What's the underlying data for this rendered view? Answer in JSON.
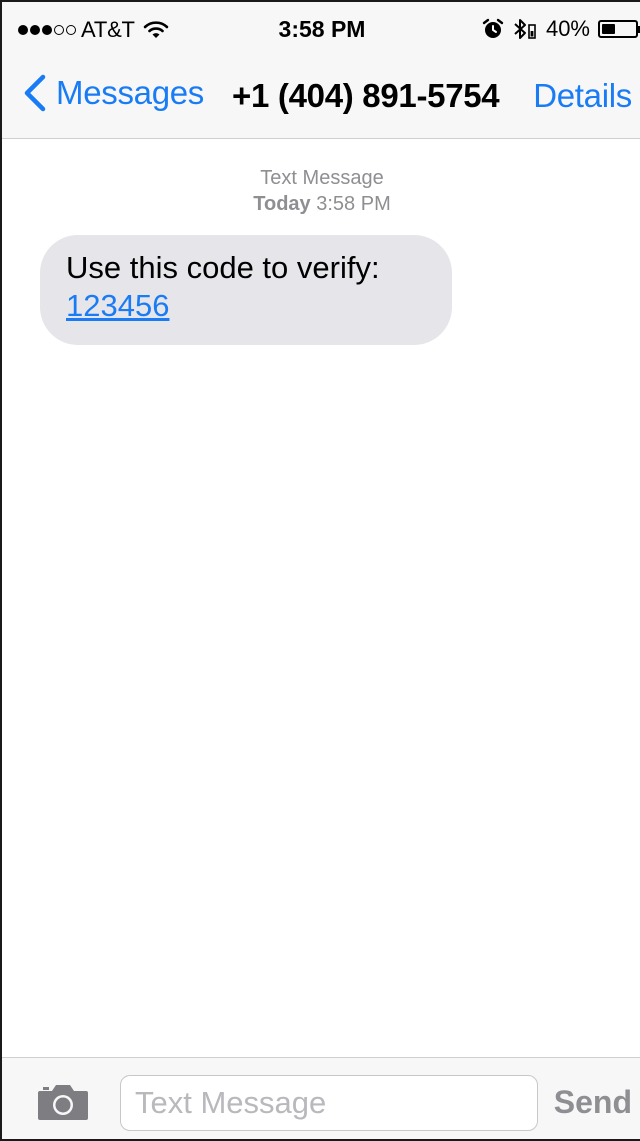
{
  "status_bar": {
    "signal_filled": 3,
    "signal_total": 5,
    "carrier": "AT&T",
    "time": "3:58 PM",
    "battery_percent_label": "40%",
    "battery_level": 0.4,
    "icons": [
      "wifi-icon",
      "alarm-icon",
      "bluetooth-icon",
      "battery-icon"
    ]
  },
  "nav": {
    "back_label": "Messages",
    "title": "+1 (404) 891-5754",
    "details_label": "Details"
  },
  "conversation": {
    "stamp_type": "Text Message",
    "stamp_day": "Today",
    "stamp_time": "3:58 PM",
    "messages": [
      {
        "direction": "incoming",
        "text": "Use this code to verify:",
        "link": "123456"
      }
    ]
  },
  "composer": {
    "placeholder": "Text Message",
    "value": "",
    "send_label": "Send",
    "camera_icon": "camera-icon"
  },
  "colors": {
    "accent": "#1a7cf5",
    "bubble_incoming": "#e5e5ea",
    "muted": "#8e8e93",
    "bar_background": "#f7f7f8"
  }
}
